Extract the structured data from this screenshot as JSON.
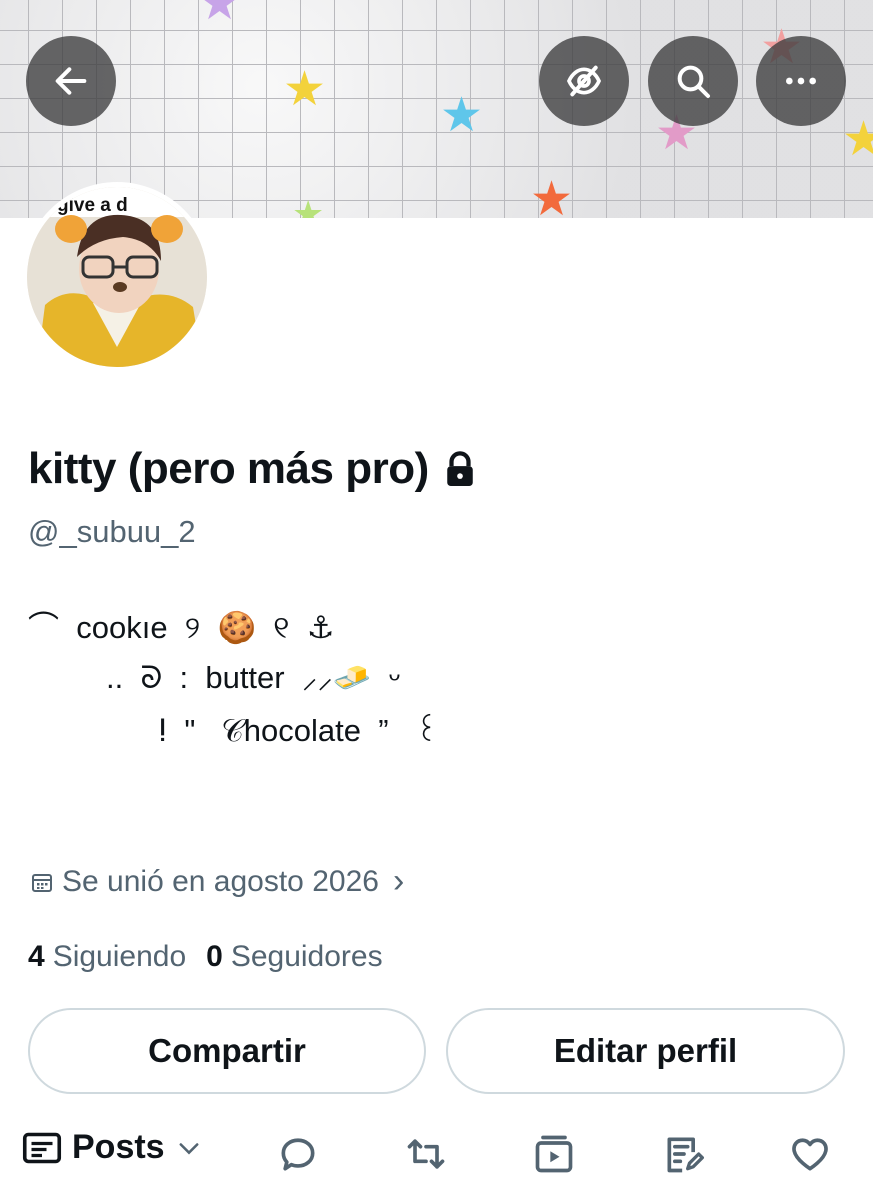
{
  "header": {
    "back_icon": "arrow-left-icon",
    "actions": [
      "hidden-eye-icon",
      "search-icon",
      "more-icon"
    ]
  },
  "profile": {
    "display_name": "kitty (pero más pro)",
    "handle": "@_subuu_2",
    "locked_icon": "lock-icon",
    "avatar_text": "give a d"
  },
  "bio": {
    "line1": "⌒  cookıe  ୨  🍪  ୧  ⚓︎",
    "line2": "..  ᘐ  :  butter  ⸝⸝🧈  ᵕ",
    "line3": "ⵑ  \"   𝒞hocolate  ”   ꒰"
  },
  "meta": {
    "joined": "Se unió en agosto 2026",
    "chevron": "›"
  },
  "stats": {
    "following_count": "4",
    "following_label": "Siguiendo",
    "followers_count": "0",
    "followers_label": "Seguidores"
  },
  "buttons": {
    "share": "Compartir",
    "edit": "Editar perfil"
  },
  "tabs": {
    "posts_label": "Posts",
    "icons": [
      "reply-icon",
      "repost-icon",
      "media-icon",
      "articles-icon",
      "like-icon"
    ]
  },
  "colors": {
    "text_primary": "#0f1419",
    "text_secondary": "#536471",
    "border": "#cfd9de"
  }
}
